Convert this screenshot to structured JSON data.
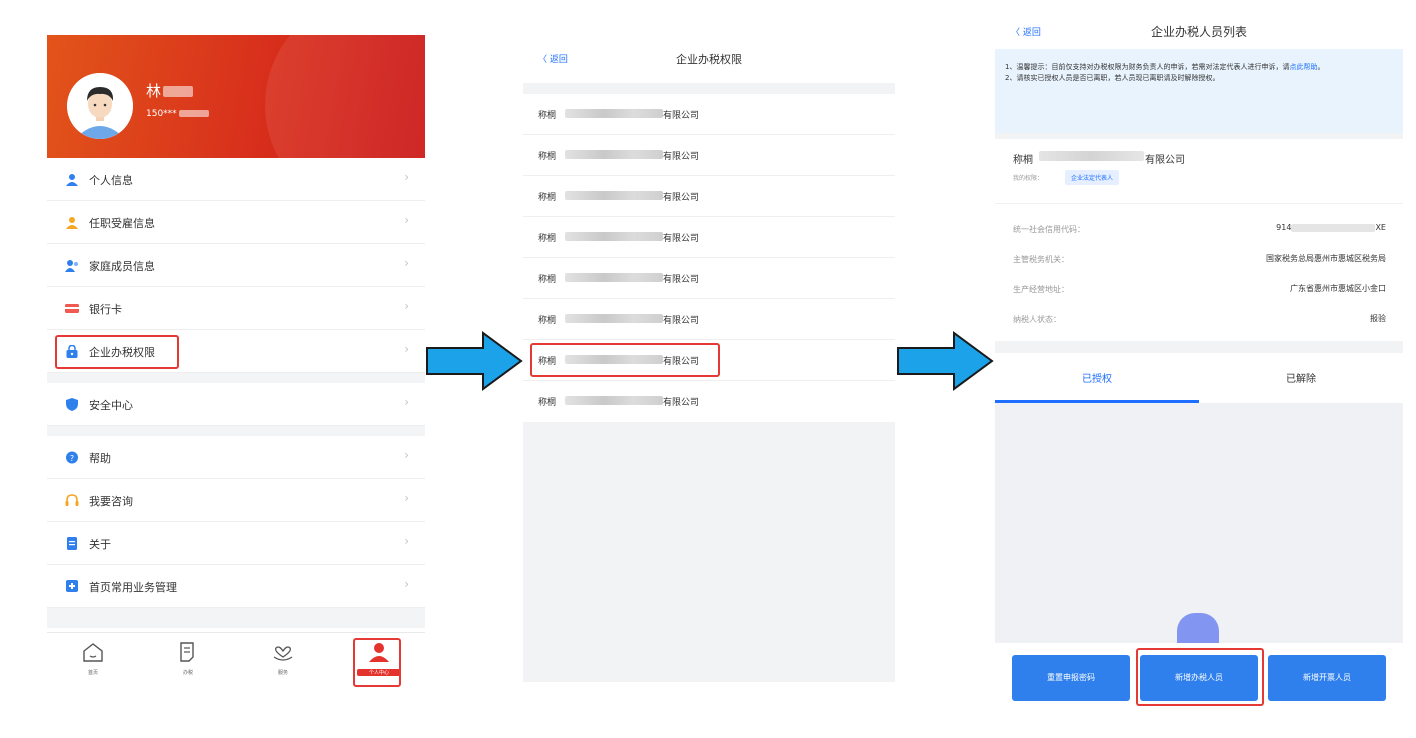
{
  "panel1": {
    "user": {
      "name": "林",
      "phone": "150***"
    },
    "menu": [
      {
        "label": "个人信息",
        "icon": "person-icon",
        "color": "#2f80ed"
      },
      {
        "label": "任职受雇信息",
        "icon": "employment-icon",
        "color": "#f5a623"
      },
      {
        "label": "家庭成员信息",
        "icon": "family-icon",
        "color": "#2f80ed"
      },
      {
        "label": "银行卡",
        "icon": "bank-card-icon",
        "color": "#f05a52"
      },
      {
        "label": "企业办税权限",
        "icon": "lock-icon",
        "color": "#2f80ed"
      },
      {
        "label": "安全中心",
        "icon": "shield-icon",
        "color": "#2f80ed"
      },
      {
        "label": "帮助",
        "icon": "help-icon",
        "color": "#2f80ed"
      },
      {
        "label": "我要咨询",
        "icon": "headset-icon",
        "color": "#f5a623"
      },
      {
        "label": "关于",
        "icon": "document-icon",
        "color": "#2f80ed"
      },
      {
        "label": "首页常用业务管理",
        "icon": "plus-box-icon",
        "color": "#2f80ed"
      }
    ],
    "tabs": [
      {
        "label": "首页",
        "icon": "home-icon"
      },
      {
        "label": "办税",
        "icon": "tax-doc-icon"
      },
      {
        "label": "服务",
        "icon": "heart-hand-icon"
      },
      {
        "label": "个人中心",
        "icon": "user-center-icon"
      }
    ],
    "chevron": "›"
  },
  "panel2": {
    "back": "〈 返回",
    "title": "企业办税权限",
    "rows": [
      {
        "prefix": "称桐",
        "suffix": "有限公司"
      },
      {
        "prefix": "称桐",
        "suffix": "有限公司"
      },
      {
        "prefix": "称桐",
        "suffix": "有限公司"
      },
      {
        "prefix": "称桐",
        "suffix": "有限公司"
      },
      {
        "prefix": "称桐",
        "suffix": "有限公司"
      },
      {
        "prefix": "称桐",
        "suffix": "有限公司"
      },
      {
        "prefix": "称桐",
        "suffix": "有限公司"
      },
      {
        "prefix": "称桐",
        "suffix": "有限公司"
      }
    ]
  },
  "panel3": {
    "back": "〈 返回",
    "title": "企业办税人员列表",
    "notice": {
      "line1": "1、温馨提示：目前仅支持对办税权限为财务负责人的申诉，若需对法定代表人进行申诉，请",
      "link": "点此帮助",
      "line1_end": "。",
      "line2": "2、请核实已授权人员是否已离职，若人员现已离职请及时解除授权。"
    },
    "company": {
      "prefix": "称桐",
      "suffix": "有限公司",
      "perm_label": "我的权限：",
      "perm_badge": "企业法定代表人"
    },
    "info": [
      {
        "k": "统一社会信用代码：",
        "v_pre": "914",
        "v_suf": "XE"
      },
      {
        "k": "主管税务机关：",
        "v": "国家税务总局惠州市惠城区税务局"
      },
      {
        "k": "生产经营地址：",
        "v": "广东省惠州市惠城区小金口"
      },
      {
        "k": "纳税人状态：",
        "v": "报验"
      }
    ],
    "tabs": {
      "authorized": "已授权",
      "removed": "已解除"
    },
    "buttons": {
      "reset": "重置申报密码",
      "add_tax": "新增办税人员",
      "add_invoice": "新增开票人员"
    }
  }
}
